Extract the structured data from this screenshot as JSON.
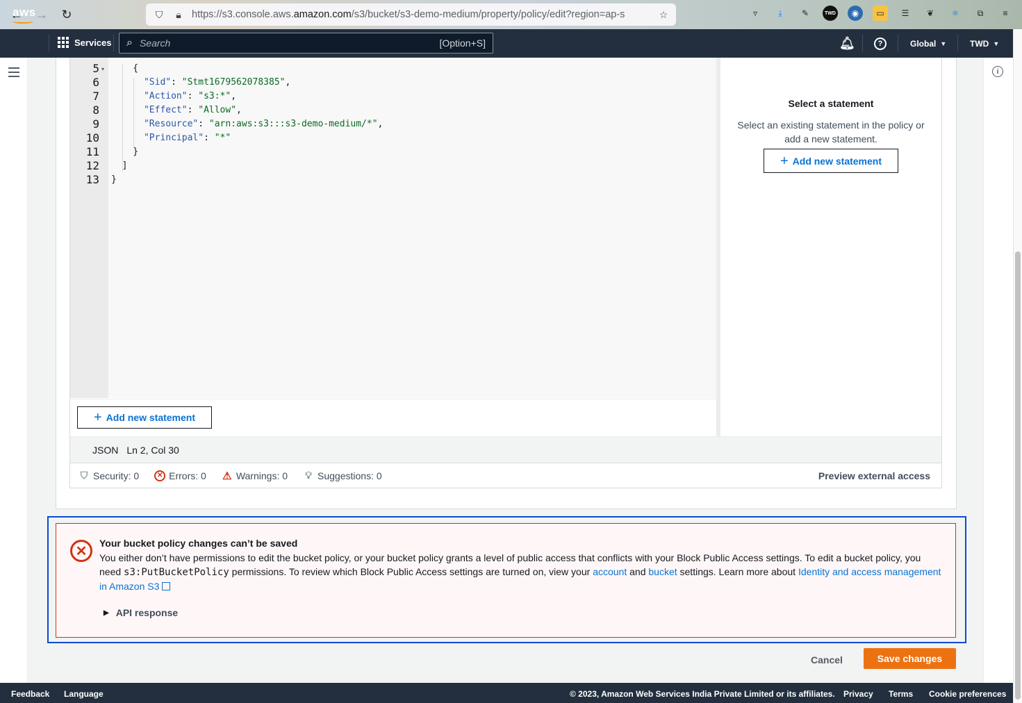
{
  "browser": {
    "url_prefix": "https://s3.console.aws.",
    "url_domain": "amazon.com",
    "url_path": "/s3/bucket/s3-demo-medium/property/policy/edit?region=ap-s",
    "ext_badge": "TWD"
  },
  "topnav": {
    "logo": "aws",
    "services_label": "Services",
    "search_placeholder": "Search",
    "search_shortcut": "[Option+S]",
    "region_label": "Global",
    "account_label": "TWD"
  },
  "editor": {
    "line_numbers": [
      "5",
      "6",
      "7",
      "8",
      "9",
      "10",
      "11",
      "12",
      "13"
    ],
    "lines": [
      {
        "pre": "    {",
        "key": "",
        "sep": "",
        "val": "",
        "post": ""
      },
      {
        "pre": "      ",
        "key": "\"Sid\"",
        "sep": ": ",
        "val": "\"Stmt1679562078385\"",
        "post": ","
      },
      {
        "pre": "      ",
        "key": "\"Action\"",
        "sep": ": ",
        "val": "\"s3:*\"",
        "post": ","
      },
      {
        "pre": "      ",
        "key": "\"Effect\"",
        "sep": ": ",
        "val": "\"Allow\"",
        "post": ","
      },
      {
        "pre": "      ",
        "key": "\"Resource\"",
        "sep": ": ",
        "val": "\"arn:aws:s3:::s3-demo-medium/*\"",
        "post": ","
      },
      {
        "pre": "      ",
        "key": "\"Principal\"",
        "sep": ": ",
        "val": "\"*\"",
        "post": ""
      },
      {
        "pre": "    }",
        "key": "",
        "sep": "",
        "val": "",
        "post": ""
      },
      {
        "pre": "  ]",
        "key": "",
        "sep": "",
        "val": "",
        "post": ""
      },
      {
        "pre": "}",
        "key": "",
        "sep": "",
        "val": "",
        "post": ""
      }
    ],
    "add_statement_label": "Add new statement",
    "mode": "JSON",
    "cursor": "Ln 2, Col 30"
  },
  "side_panel": {
    "title": "Select a statement",
    "description": "Select an existing statement in the policy or add a new statement.",
    "add_statement_label": "Add new statement"
  },
  "lint": {
    "security": "Security: 0",
    "errors": "Errors: 0",
    "warnings": "Warnings: 0",
    "suggestions": "Suggestions: 0",
    "preview_label": "Preview external access"
  },
  "alert": {
    "title": "Your bucket policy changes can’t be saved",
    "body_1": "You either don’t have permissions to edit the bucket policy, or your bucket policy grants a level of public access that conflicts with your Block Public Access settings. To edit a bucket policy, you need ",
    "permission_code": "s3:PutBucketPolicy",
    "body_2": " permissions. To review which Block Public Access settings are turned on, view your ",
    "account_link": "account",
    "body_3": " and ",
    "bucket_link": "bucket",
    "body_4": " settings. Learn more about ",
    "iam_link": "Identity and access management in Amazon S3",
    "api_response_label": "API response"
  },
  "actions": {
    "cancel_label": "Cancel",
    "save_label": "Save changes"
  },
  "footer": {
    "feedback": "Feedback",
    "language": "Language",
    "copyright": "© 2023, Amazon Web Services India Private Limited or its affiliates.",
    "privacy": "Privacy",
    "terms": "Terms",
    "cookies": "Cookie preferences"
  },
  "colors": {
    "aws_nav": "#232f3e",
    "link": "#0972d3",
    "error": "#d13212",
    "primary_button": "#ec7211"
  }
}
